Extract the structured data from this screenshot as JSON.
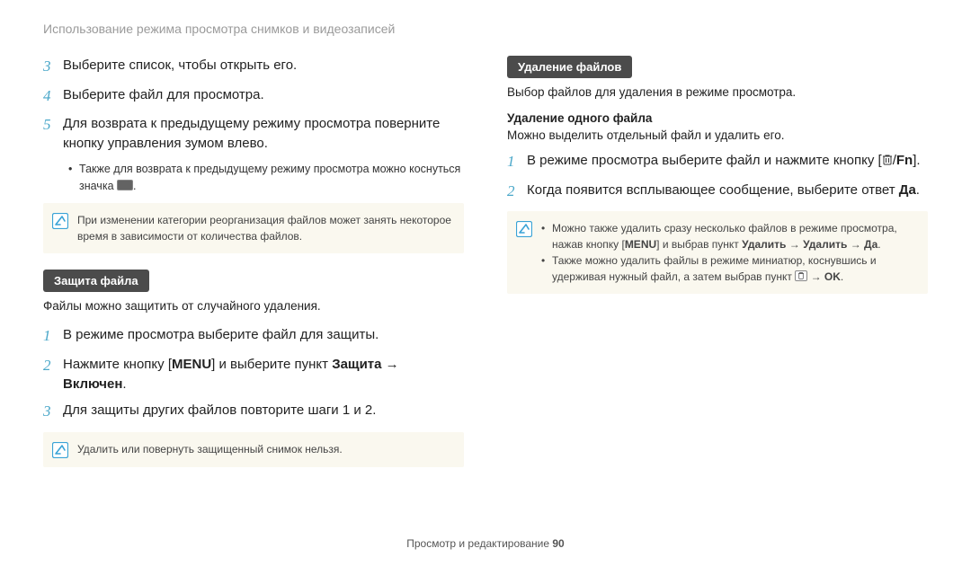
{
  "header": "Использование режима просмотра снимков и видеозаписей",
  "left": {
    "step3": {
      "num": "3",
      "text": "Выберите список, чтобы открыть его."
    },
    "step4": {
      "num": "4",
      "text": "Выберите файл для просмотра."
    },
    "step5": {
      "num": "5",
      "text": "Для возврата к предыдущему режиму просмотра поверните кнопку управления зумом влево."
    },
    "bullet1_a": "Также для возврата к предыдущему режиму просмотра можно коснуться значка ",
    "bullet1_b": ".",
    "note1": "При изменении категории реорганизация файлов может занять некоторое время в зависимости от количества файлов.",
    "badge": "Защита файла",
    "sub": "Файлы можно защитить от случайного удаления.",
    "p1": {
      "num": "1",
      "text": "В режиме просмотра выберите файл для защиты."
    },
    "p2": {
      "num": "2",
      "a": "Нажмите кнопку [",
      "b": "] и выберите пункт ",
      "c": "Защита",
      "d": "Включен"
    },
    "p3": {
      "num": "3",
      "text": "Для защиты других файлов повторите шаги 1 и 2."
    },
    "note2": "Удалить или повернуть защищенный снимок нельзя."
  },
  "right": {
    "badge": "Удаление файлов",
    "sub": "Выбор файлов для удаления в режиме просмотра.",
    "subhead": "Удаление одного файла",
    "subtext": "Можно выделить отдельный файл и удалить его.",
    "d1": {
      "num": "1",
      "a": "В режиме просмотра выберите файл и нажмите кнопку [",
      "b": "/",
      "fn": "Fn",
      "c": "]."
    },
    "d2": {
      "num": "2",
      "a": "Когда появится всплывающее сообщение, выберите ответ ",
      "b": "Да"
    },
    "noteA_a": "Можно также удалить сразу несколько файлов в режиме просмотра, нажав кнопку [",
    "noteA_b": "] и выбрав пункт ",
    "noteA_c": "Удалить",
    "noteA_d": "Удалить",
    "noteA_e": "Да",
    "noteB_a": "Также можно удалить файлы в режиме миниатюр, коснувшись и удерживая нужный файл, а затем выбрав пункт ",
    "noteB_b": "OK"
  },
  "footer": {
    "text": "Просмотр и редактирование",
    "page": "  90"
  },
  "menu_label": "MENU"
}
